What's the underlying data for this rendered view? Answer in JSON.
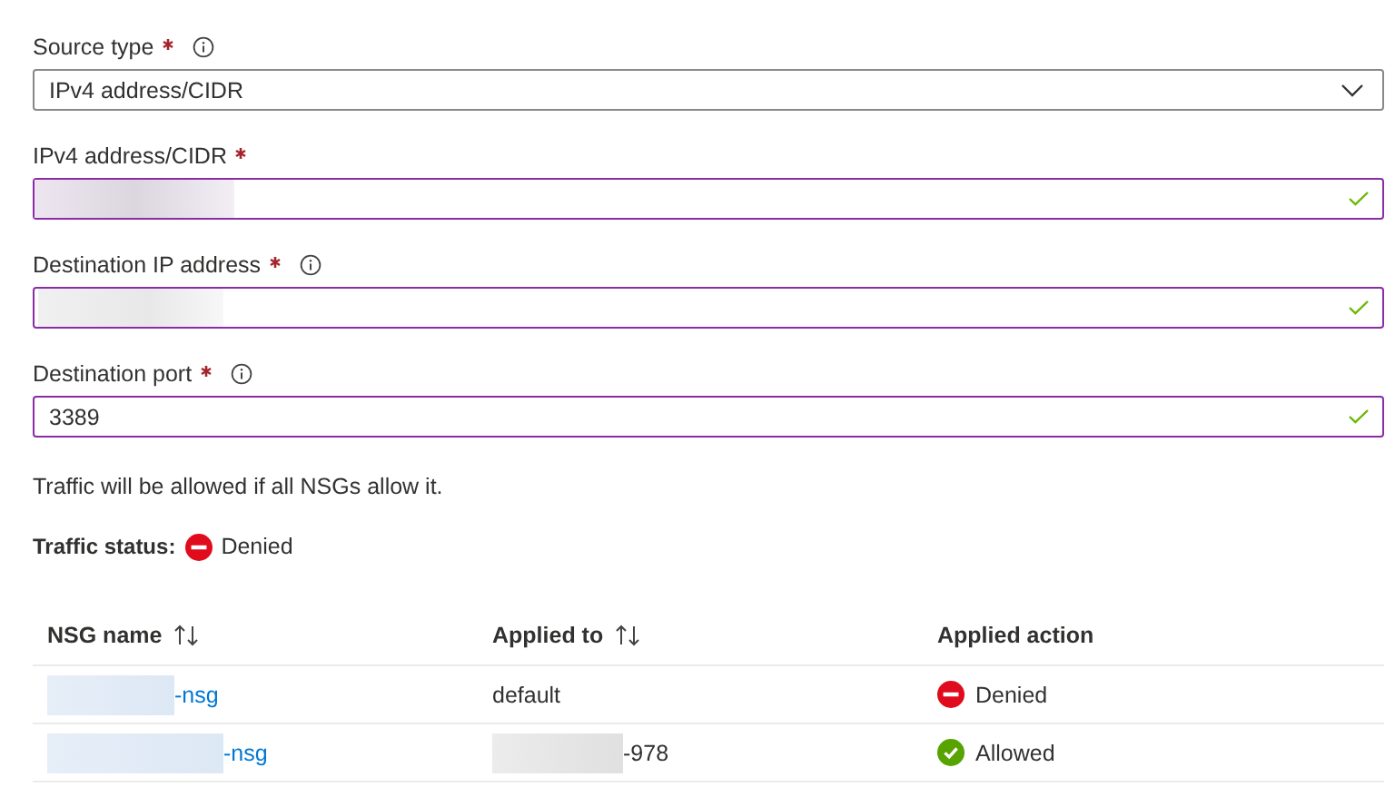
{
  "fields": [
    {
      "kind": "select",
      "label": "Source type",
      "required": true,
      "info": true,
      "value": "IPv4 address/CIDR"
    },
    {
      "kind": "text",
      "label": "IPv4 address/CIDR",
      "required": true,
      "valid": true,
      "redacted": true
    },
    {
      "kind": "text",
      "label": "Destination IP address",
      "required": true,
      "info": true,
      "valid": true,
      "redacted": true
    },
    {
      "kind": "text",
      "label": "Destination port",
      "required": true,
      "info": true,
      "value": "3389",
      "valid": true
    }
  ],
  "note": "Traffic will be allowed if all NSGs allow it.",
  "traffic_status": {
    "label": "Traffic status:",
    "allowed": false,
    "text": "Denied"
  },
  "table": {
    "columns": [
      {
        "label": "NSG name",
        "sortable": true
      },
      {
        "label": "Applied to",
        "sortable": true
      },
      {
        "label": "Applied action"
      }
    ],
    "rows": [
      {
        "nsg_name": "-nsg",
        "nsg_redacted": true,
        "applied_to": "default",
        "action": {
          "allowed": false,
          "text": "Denied"
        }
      },
      {
        "nsg_name": "-nsg",
        "nsg_redacted": true,
        "applied_to": "-978",
        "applied_redacted": true,
        "action": {
          "allowed": true,
          "text": "Allowed"
        }
      }
    ]
  }
}
